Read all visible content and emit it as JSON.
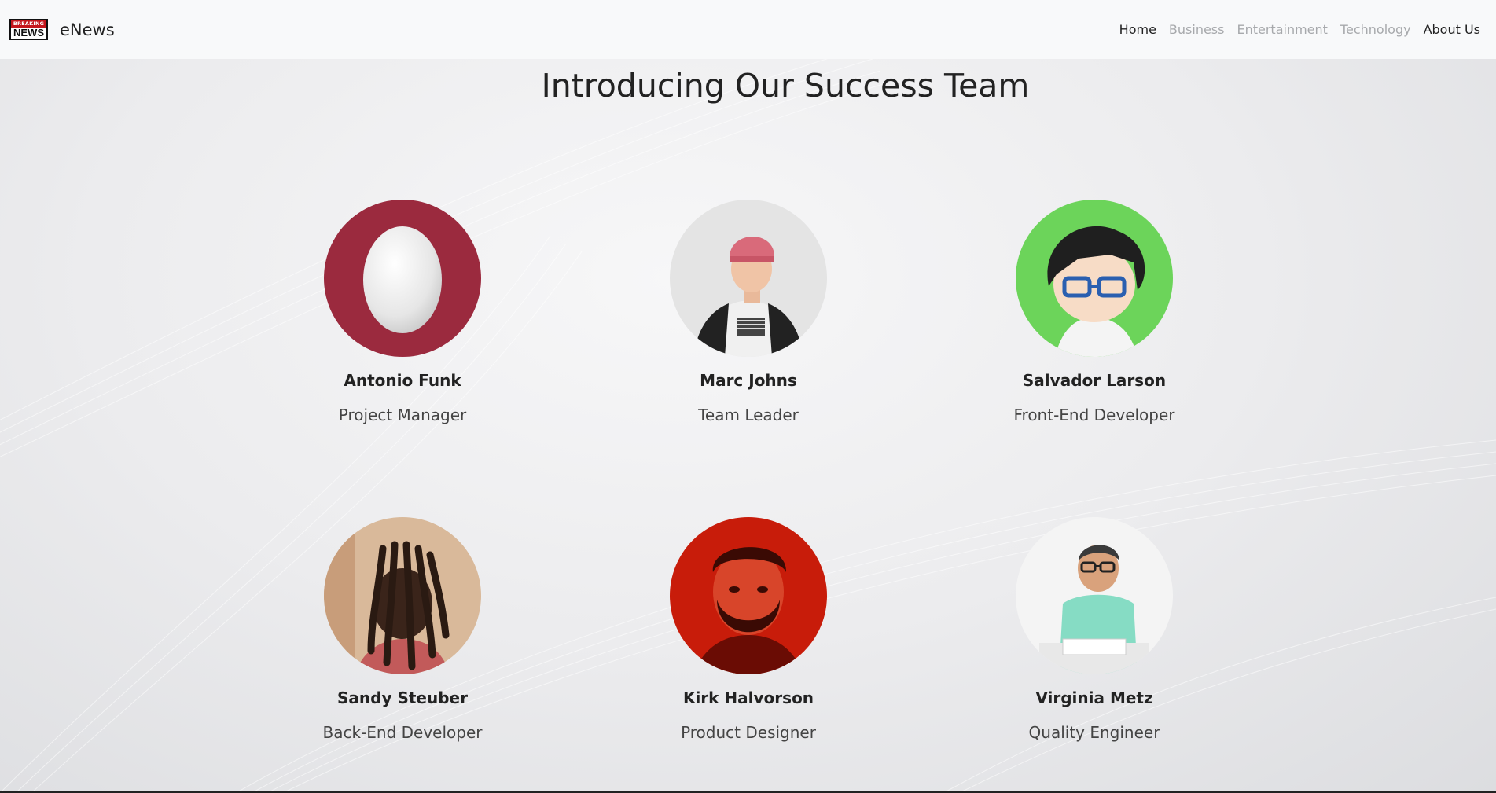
{
  "brand": {
    "logo_top": "BREAKING",
    "logo_bottom": "NEWS",
    "name": "eNews"
  },
  "nav": {
    "items": [
      {
        "label": "Home",
        "active": true
      },
      {
        "label": "Business",
        "active": false
      },
      {
        "label": "Entertainment",
        "active": false
      },
      {
        "label": "Technology",
        "active": false
      },
      {
        "label": "About Us",
        "active": true
      }
    ]
  },
  "page": {
    "title": "Introducing Our Success Team"
  },
  "team": [
    {
      "name": "Antonio Funk",
      "role": "Project Manager",
      "avatar": "egg-avatar"
    },
    {
      "name": "Marc Johns",
      "role": "Team Leader",
      "avatar": "photo-man-beanie"
    },
    {
      "name": "Salvador Larson",
      "role": "Front-End Developer",
      "avatar": "cartoon-boy-glasses"
    },
    {
      "name": "Sandy Steuber",
      "role": "Back-End Developer",
      "avatar": "photo-dreadlocks"
    },
    {
      "name": "Kirk Halvorson",
      "role": "Product Designer",
      "avatar": "photo-red-beard"
    },
    {
      "name": "Virginia Metz",
      "role": "Quality Engineer",
      "avatar": "photo-man-desk"
    }
  ],
  "colors": {
    "egg_bg": "#9b2a3e",
    "cartoon_bg": "#6cd45a",
    "red_bg": "#c81c0a",
    "nav_active": "#222222",
    "nav_inactive": "#a7a9ac"
  }
}
